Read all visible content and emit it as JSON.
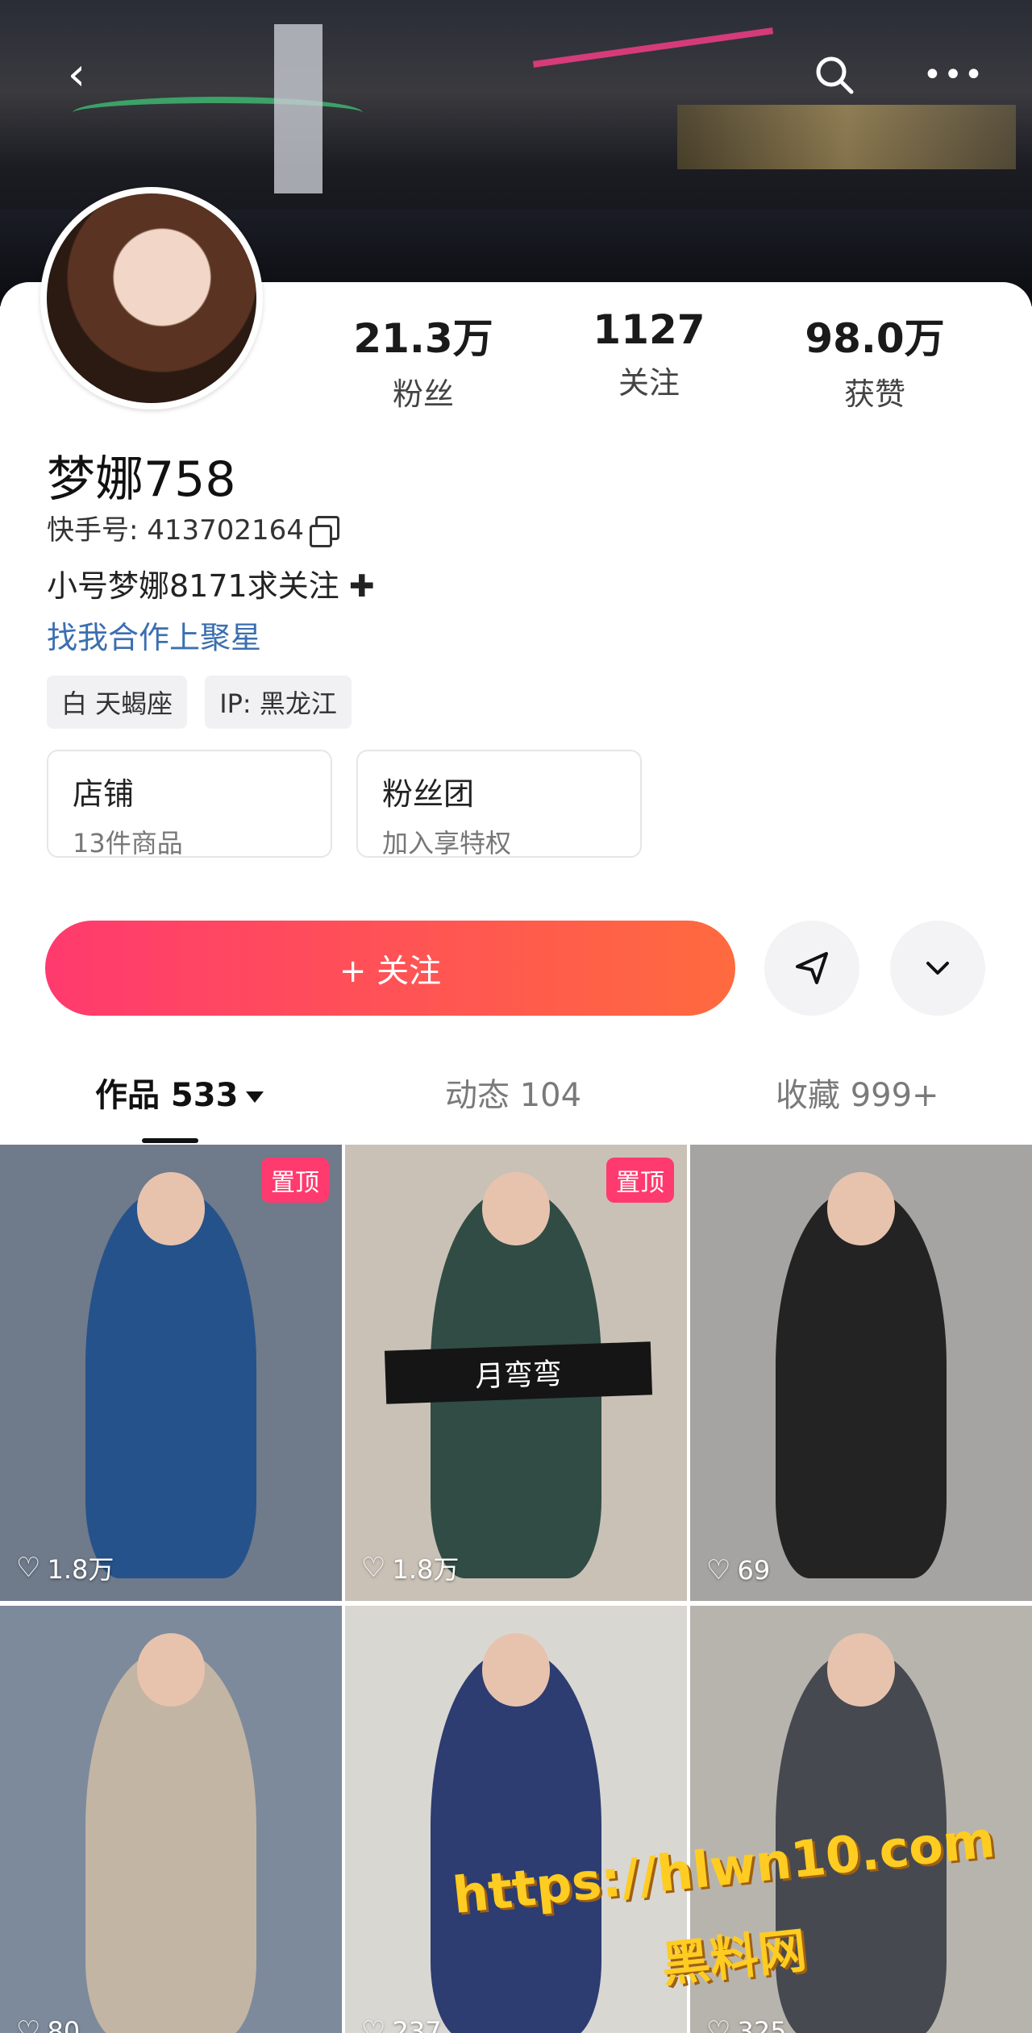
{
  "header": {
    "back_icon": "chevron-left-icon",
    "search_icon": "search-icon",
    "more_icon": "more-icon"
  },
  "profile": {
    "name": "梦娜758",
    "kuaishou_id": "快手号: 413702164",
    "bio": "小号梦娜8171求关注",
    "bio_link": "找我合作上聚星",
    "tags": [
      "白 天蝎座",
      "IP: 黑龙江"
    ]
  },
  "stats": [
    {
      "value": "21.3万",
      "label": "粉丝"
    },
    {
      "value": "1127",
      "label": "关注"
    },
    {
      "value": "98.0万",
      "label": "获赞"
    }
  ],
  "boxes": [
    {
      "title": "店铺",
      "subtitle": "13件商品"
    },
    {
      "title": "粉丝团",
      "subtitle": "加入享特权"
    }
  ],
  "actions": {
    "follow_label": "+ 关注",
    "share_icon": "send-icon",
    "expand_icon": "chevron-down-icon"
  },
  "tabs": [
    {
      "label": "作品 533"
    },
    {
      "label": "动态 104"
    },
    {
      "label": "收藏 999+"
    }
  ],
  "grid": [
    {
      "likes": "1.8万",
      "pinned": "置顶",
      "bg": "#6f7a8a"
    },
    {
      "likes": "1.8万",
      "pinned": "置顶",
      "overlay": "月弯弯",
      "bg": "#c9c1b6"
    },
    {
      "likes": "69",
      "bg": "#a5a4a3"
    },
    {
      "likes": "80",
      "bg": "#7c8a9c"
    },
    {
      "likes": "237",
      "bg": "#d9d7d2"
    },
    {
      "likes": "325",
      "bg": "#b7b4ae"
    }
  ],
  "watermark": {
    "line1": "https://hlwn10.com",
    "line2": "黑料网"
  }
}
